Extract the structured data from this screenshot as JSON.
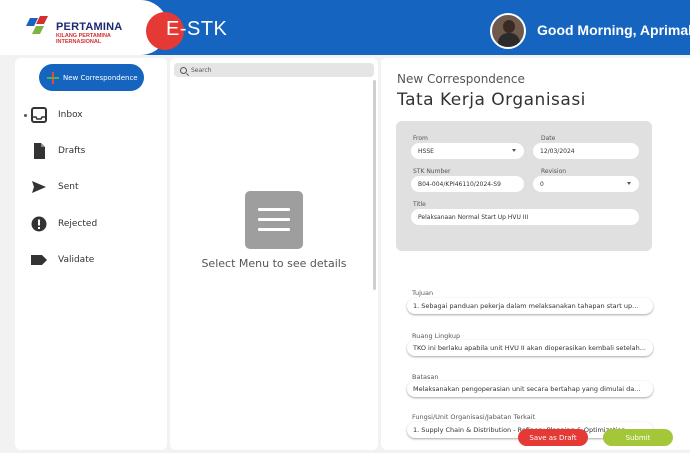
{
  "header": {
    "logo_title": "PERTAMINA",
    "logo_subtitle_1": "KILANG PERTAMINA",
    "logo_subtitle_2": "INTERNASIONAL",
    "app_name": "E-STK",
    "greeting": "Good Morning, Aprimal",
    "colors": {
      "bar": "#1565c0",
      "badge": "#e53935"
    }
  },
  "sidebar": {
    "new_button": "New Correspondence",
    "items": [
      {
        "label": "Inbox",
        "icon": "inbox-icon"
      },
      {
        "label": "Drafts",
        "icon": "document-icon"
      },
      {
        "label": "Sent",
        "icon": "send-icon"
      },
      {
        "label": "Rejected",
        "icon": "exclamation-icon"
      },
      {
        "label": "Validate",
        "icon": "label-icon"
      }
    ]
  },
  "list_panel": {
    "search_placeholder": "Search",
    "empty_message": "Select Menu to see details"
  },
  "detail": {
    "kicker": "New Correspondence",
    "title": "Tata Kerja Organisasi",
    "form": {
      "from_label": "From",
      "from_value": "HSSE",
      "date_label": "Date",
      "date_value": "12/03/2024",
      "stk_label": "STK Number",
      "stk_value": "B04-004/KPI46110/2024-S9",
      "revision_label": "Revision",
      "revision_value": "0",
      "title_label": "Title",
      "title_value": "Pelaksanaan Normal Start Up HVU III"
    },
    "sections": [
      {
        "label": "Tujuan",
        "value": "1. Sebagai panduan pekerja dalam melaksanakan tahapan start up..."
      },
      {
        "label": "Ruang Lingkup",
        "value": "TKO ini berlaku apabila unit HVU II akan dioperasikan kembali setelah..."
      },
      {
        "label": "Batasan",
        "value": "Melaksanakan pengoperasian unit secara bertahap yang dimulai da..."
      },
      {
        "label": "Fungsi/Unit Organisasi/Jabatan Terkait",
        "value": "1. Supply Chain & Distribution - Refinery Planning & Optimization"
      }
    ],
    "save_draft": "Save as Draft",
    "submit": "Submit"
  }
}
